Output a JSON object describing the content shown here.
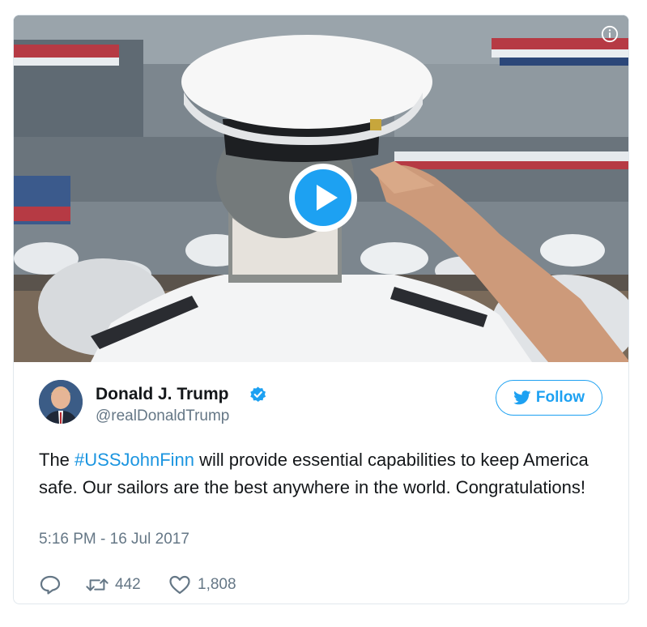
{
  "media": {
    "play_icon": "play-icon",
    "info_icon": "info-icon"
  },
  "author": {
    "name": "Donald J. Trump",
    "handle": "@realDonaldTrump",
    "verified_icon": "verified-badge-icon"
  },
  "follow_button": {
    "label": "Follow",
    "icon": "twitter-bird-icon"
  },
  "tweet": {
    "text_before": "The ",
    "hashtag": "#USSJohnFinn",
    "text_after": " will provide essential capabilities to keep America safe. Our sailors are the best anywhere in the world. Congratulations!",
    "timestamp": "5:16 PM - 16 Jul 2017"
  },
  "actions": {
    "reply_icon": "reply-icon",
    "retweet_count": "442",
    "retweet_icon": "retweet-icon",
    "like_count": "1,808",
    "like_icon": "heart-icon"
  },
  "colors": {
    "accent": "#1da1f2",
    "hashtag": "#1b95e0",
    "secondary_text": "#657786",
    "primary_text": "#14171a",
    "border": "#e1e8ed"
  }
}
